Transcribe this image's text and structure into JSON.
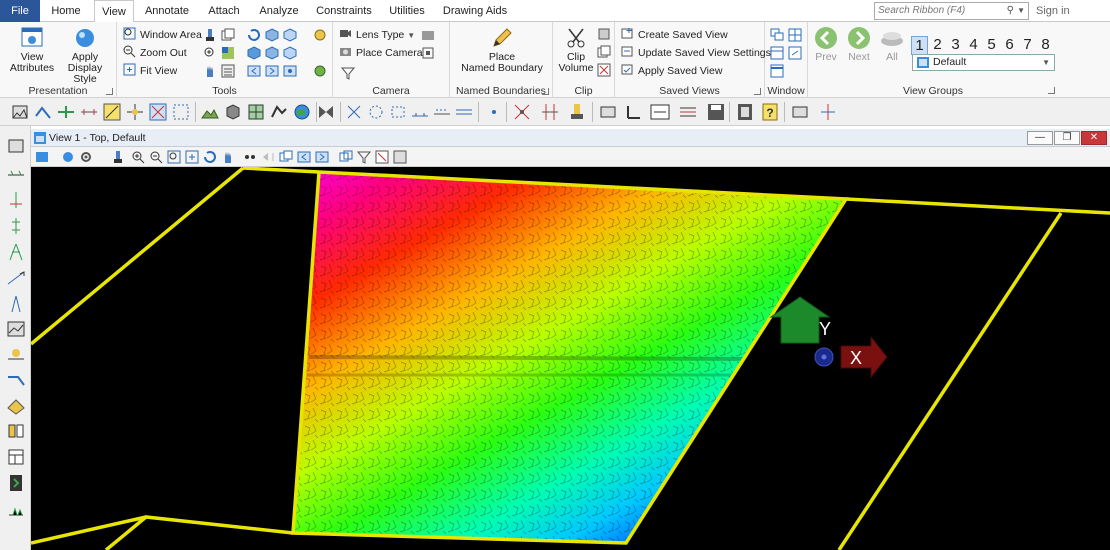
{
  "tabs": {
    "file": "File",
    "home": "Home",
    "view": "View",
    "annotate": "Annotate",
    "attach": "Attach",
    "analyze": "Analyze",
    "constraints": "Constraints",
    "utilities": "Utilities",
    "drawing_aids": "Drawing Aids"
  },
  "search": {
    "placeholder": "Search Ribbon (F4)"
  },
  "sign_in": "Sign in",
  "ribbon": {
    "presentation": {
      "label": "Presentation",
      "view_attributes_1": "View",
      "view_attributes_2": "Attributes",
      "apply_display_style_1": "Apply",
      "apply_display_style_2": "Display Style"
    },
    "tools": {
      "label": "Tools",
      "window_area": "Window Area",
      "zoom_out": "Zoom Out",
      "fit_view": "Fit View"
    },
    "camera": {
      "label": "Camera",
      "lens_type": "Lens Type",
      "place_camera": "Place Camera"
    },
    "named_boundaries": {
      "label": "Named Boundaries",
      "place_1": "Place",
      "place_2": "Named Boundary"
    },
    "clip": {
      "label": "Clip",
      "clip_volume_1": "Clip",
      "clip_volume_2": "Volume"
    },
    "saved_views": {
      "label": "Saved Views",
      "create": "Create Saved View",
      "update_settings": "Update Saved View Settings",
      "apply": "Apply Saved View"
    },
    "window": {
      "label": "Window"
    },
    "view_groups": {
      "label": "View Groups",
      "prev": "Prev",
      "next": "Next",
      "all": "All",
      "numbers": [
        "1",
        "2",
        "3",
        "4",
        "5",
        "6",
        "7",
        "8"
      ],
      "selected_number": "1",
      "group_selected": "Default"
    }
  },
  "view_window": {
    "title": "View 1 - Top, Default"
  },
  "axis": {
    "y_label": "Y",
    "x_label": "X"
  },
  "colors": {
    "file_tab": "#2b579a",
    "boundary": "#e8e600",
    "background": "#000000",
    "y_arrow": "#1c8a2a",
    "x_arrow": "#7a1010"
  }
}
